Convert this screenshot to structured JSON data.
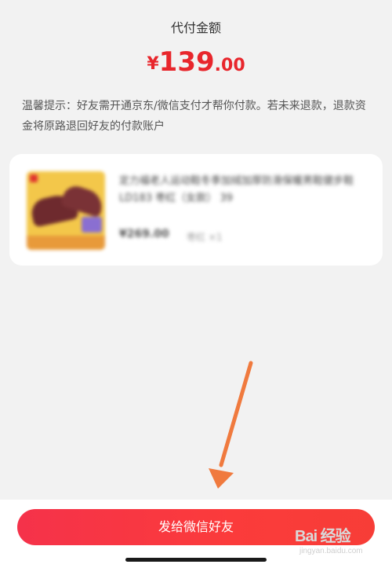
{
  "payment": {
    "amount_label": "代付金额",
    "currency_symbol": "¥",
    "amount_integer": "139",
    "amount_decimal": ".00"
  },
  "tip": {
    "text": "温馨提示：好友需开通京东/微信支付才帮你付款。若未来退款，退款资金将原路退回好友的付款账户"
  },
  "product": {
    "title": "定力福老人运动鞋冬季加绒加厚防滑保暖男鞋健步鞋LD183 枣红（女款） 39",
    "price": "¥269.00",
    "spec": "枣红 ×1"
  },
  "actions": {
    "send_label": "发给微信好友"
  },
  "watermark": {
    "main": "Bai 经验",
    "sub": "jingyan.baidu.com"
  },
  "colors": {
    "accent": "#e8262c",
    "button": "#f73d3d",
    "arrow": "#f07a3e",
    "background": "#f2f2f2"
  }
}
